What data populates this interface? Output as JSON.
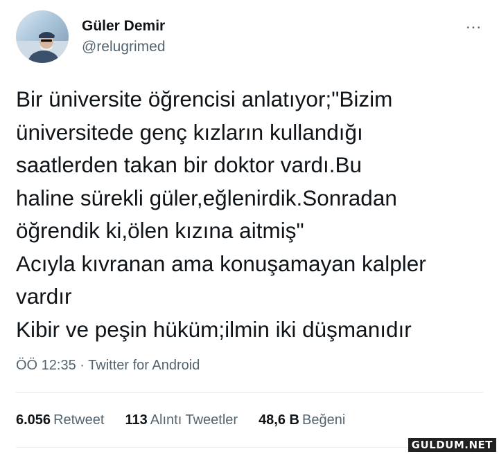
{
  "user": {
    "name": "Güler Demir",
    "handle": "@relugrimed"
  },
  "more_icon": "...",
  "tweet_lines": [
    "Bir üniversite öğrencisi anlatıyor;\"Bizim",
    "üniversitede genç kızların kullandığı",
    "saatlerden takan bir doktor vardı.Bu",
    "haline sürekli güler,eğlenirdik.Sonradan",
    "öğrendik ki,ölen kızına aitmiş\"",
    "Acıyla kıvranan ama konuşamayan kalpler",
    "vardır",
    "Kibir ve peşin hüküm;ilmin iki düşmanıdır"
  ],
  "meta": {
    "time": "ÖÖ 12:35",
    "separator": " · ",
    "source": "Twitter for Android"
  },
  "stats": {
    "retweets": {
      "count": "6.056",
      "label": "Retweet"
    },
    "quotes": {
      "count": "113",
      "label": "Alıntı Tweetler"
    },
    "likes": {
      "count": "48,6 B",
      "label": "Beğeni"
    }
  },
  "watermark": "GULDUM.NET"
}
